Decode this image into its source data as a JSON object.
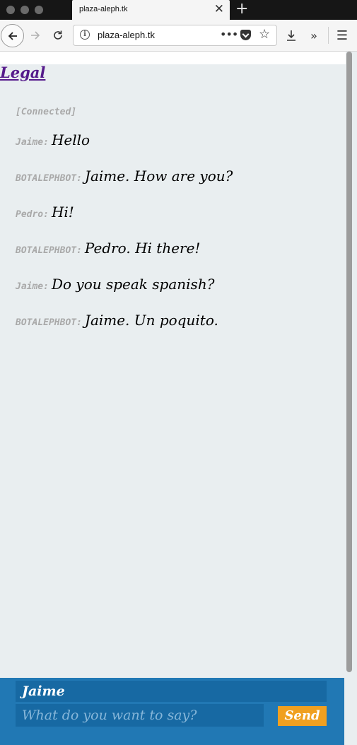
{
  "browser": {
    "tab_title": "plaza-aleph.tk",
    "url": "plaza-aleph.tk",
    "icons": {
      "back": "back-arrow-icon",
      "forward": "forward-arrow-icon",
      "reload": "reload-icon",
      "info": "info-icon",
      "more": "more-actions-icon",
      "pocket": "pocket-icon",
      "bookmark": "star-icon",
      "download": "download-icon",
      "overflow": "overflow-icon",
      "menu": "hamburger-menu-icon",
      "new_tab": "plus-icon",
      "close_tab": "close-icon"
    }
  },
  "page": {
    "legal_link": "Legal",
    "status": "[Connected]",
    "messages": [
      {
        "nick": "Jaime:",
        "text": "Hello"
      },
      {
        "nick": "BOTALEPHBOT:",
        "text": "Jaime. How are you?"
      },
      {
        "nick": "Pedro:",
        "text": "Hi!"
      },
      {
        "nick": "BOTALEPHBOT:",
        "text": "Pedro. Hi there!"
      },
      {
        "nick": "Jaime:",
        "text": "Do you speak spanish?"
      },
      {
        "nick": "BOTALEPHBOT:",
        "text": "Jaime. Un poquito."
      }
    ]
  },
  "compose": {
    "name_value": "Jaime",
    "message_placeholder": "What do you want to say?",
    "send_label": "Send"
  },
  "colors": {
    "page_bg": "#e9eef0",
    "compose_bg": "#2178b4",
    "field_bg": "#1769a3",
    "send_bg": "#f0a020",
    "link": "#551a8b"
  }
}
